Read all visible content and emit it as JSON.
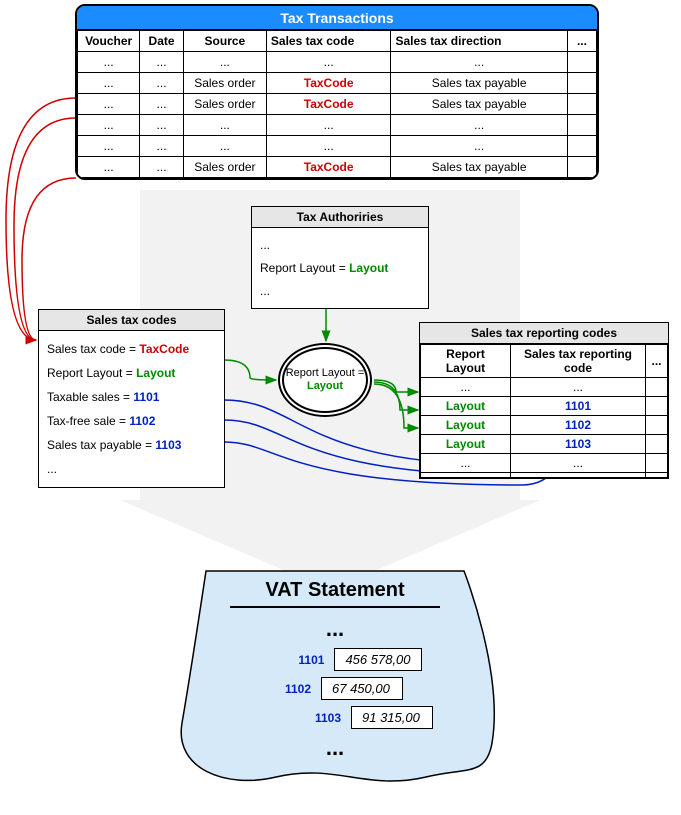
{
  "tx": {
    "title": "Tax Transactions",
    "headers": [
      "Voucher",
      "Date",
      "Source",
      "Sales tax code",
      "Sales tax direction",
      "..."
    ],
    "rows": [
      {
        "v": "...",
        "d": "...",
        "s": "...",
        "c": "...",
        "dir": "...",
        "x": ""
      },
      {
        "v": "...",
        "d": "...",
        "s": "Sales order",
        "c": "TaxCode",
        "dir": "Sales tax payable",
        "x": ""
      },
      {
        "v": "...",
        "d": "...",
        "s": "Sales order",
        "c": "TaxCode",
        "dir": "Sales tax payable",
        "x": ""
      },
      {
        "v": "...",
        "d": "...",
        "s": "...",
        "c": "...",
        "dir": "...",
        "x": ""
      },
      {
        "v": "...",
        "d": "...",
        "s": "...",
        "c": "...",
        "dir": "...",
        "x": ""
      },
      {
        "v": "...",
        "d": "...",
        "s": "Sales order",
        "c": "TaxCode",
        "dir": "Sales tax payable",
        "x": ""
      }
    ]
  },
  "auth": {
    "title": "Tax Authoriries",
    "l1": "...",
    "l2a": "Report Layout = ",
    "l2b": "Layout",
    "l3": "..."
  },
  "codes": {
    "title": "Sales tax codes",
    "l1a": "Sales tax code = ",
    "l1b": "TaxCode",
    "l2a": "Report Layout = ",
    "l2b": "Layout",
    "l3a": "Taxable sales = ",
    "l3b": "1101",
    "l4a": "Tax-free sale = ",
    "l4b": "1102",
    "l5a": "Sales tax payable = ",
    "l5b": "1103",
    "l6": "..."
  },
  "oval": {
    "l1": "Report Layout =",
    "l2": "Layout"
  },
  "rpt": {
    "title": "Sales tax reporting codes",
    "headers": [
      "Report Layout",
      "Sales tax reporting code",
      "..."
    ],
    "rows": [
      {
        "a": "...",
        "b": "...",
        "c": ""
      },
      {
        "a": "Layout",
        "b": "1101",
        "c": ""
      },
      {
        "a": "Layout",
        "b": "1102",
        "c": ""
      },
      {
        "a": "Layout",
        "b": "1103",
        "c": ""
      },
      {
        "a": "...",
        "b": "...",
        "c": ""
      },
      {
        "a": "",
        "b": "",
        "c": ""
      }
    ]
  },
  "vat": {
    "title": "VAT Statement",
    "dots": "...",
    "items": [
      {
        "code": "1101",
        "val": "456 578,00"
      },
      {
        "code": "1102",
        "val": "67 450,00"
      },
      {
        "code": "1103",
        "val": "91 315,00"
      }
    ]
  }
}
